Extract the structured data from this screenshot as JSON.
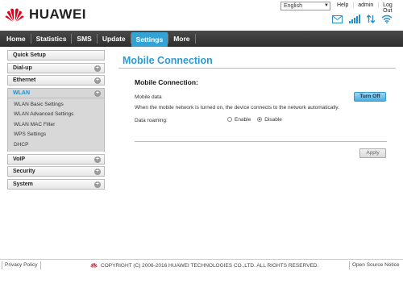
{
  "header": {
    "brand": "HUAWEI",
    "language": "English",
    "links": {
      "help": "Help",
      "user": "admin",
      "logout": "Log Out"
    },
    "icons": [
      "mail-icon",
      "signal-icon",
      "data-transfer-icon",
      "wifi-icon"
    ],
    "accent_color": "#33a3d6",
    "logo_color": "#e3001b"
  },
  "nav": {
    "items": [
      {
        "label": "Home"
      },
      {
        "label": "Statistics"
      },
      {
        "label": "SMS"
      },
      {
        "label": "Update"
      },
      {
        "label": "Settings",
        "active": true
      },
      {
        "label": "More"
      }
    ]
  },
  "sidebar": {
    "items": [
      {
        "label": "Quick Setup"
      },
      {
        "label": "Dial-up"
      },
      {
        "label": "Ethernet"
      },
      {
        "label": "WLAN",
        "open": true,
        "children": [
          "WLAN Basic Settings",
          "WLAN Advanced Settings",
          "WLAN MAC Filter",
          "WPS Settings",
          "DHCP"
        ]
      },
      {
        "label": "VoIP"
      },
      {
        "label": "Security"
      },
      {
        "label": "System"
      }
    ],
    "expand_glyph": "+"
  },
  "main": {
    "title": "Mobile Connection",
    "section_title": "Mobile Connection:",
    "mobile_data_label": "Mobile data",
    "turn_off_label": "Turn Off",
    "note": "When the mobile network is turned on, the device connects to the network automatically.",
    "roaming_label": "Data roaming:",
    "roaming_options": {
      "enable": "Enable",
      "disable": "Disable"
    },
    "roaming_selected": "Disable",
    "apply_label": "Apply"
  },
  "footer": {
    "privacy": "Privacy Policy",
    "copyright": "COPYRIGHT (C) 2006-2016 HUAWEI TECHNOLOGIES CO.,LTD. ALL RIGHTS RESERVED.",
    "open_source": "Open Source Notice"
  }
}
